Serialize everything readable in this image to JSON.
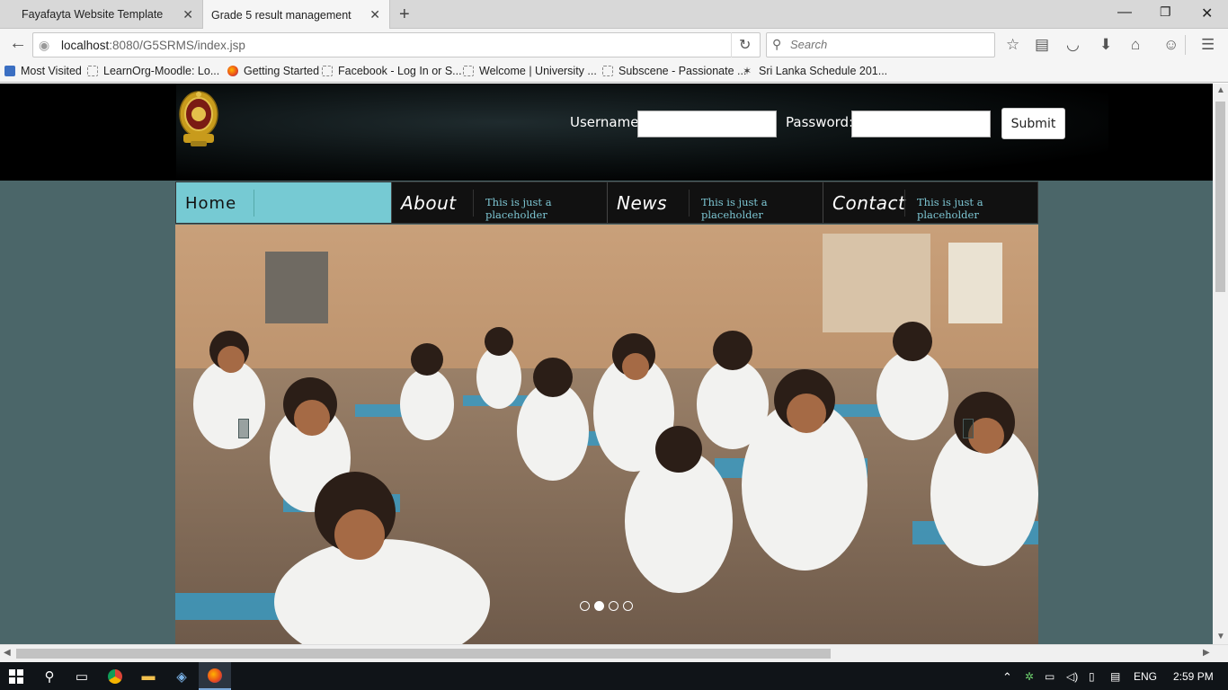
{
  "browser": {
    "tabs": [
      {
        "title": "Fayafayta Website Template",
        "active": false
      },
      {
        "title": "Grade 5 result management",
        "active": true
      }
    ],
    "url_host": "localhost",
    "url_rest": ":8080/G5SRMS/index.jsp",
    "search_placeholder": "Search",
    "bookmarks": [
      {
        "label": "Most Visited",
        "icon": "most-visited-icon"
      },
      {
        "label": "LearnOrg-Moodle: Lo...",
        "icon": "page-icon"
      },
      {
        "label": "Getting Started",
        "icon": "firefox-icon"
      },
      {
        "label": "Facebook - Log In or S...",
        "icon": "page-icon"
      },
      {
        "label": "Welcome | University ...",
        "icon": "page-icon"
      },
      {
        "label": "Subscene - Passionate ...",
        "icon": "page-icon"
      },
      {
        "label": "Sri Lanka Schedule 201...",
        "icon": "star-icon"
      }
    ]
  },
  "site": {
    "login": {
      "username_label": "Username:",
      "password_label": "Password:",
      "submit_label": "Submit"
    },
    "menu": [
      {
        "name": "Home",
        "desc": ""
      },
      {
        "name": "About",
        "desc": "This is just a placeholder"
      },
      {
        "name": "News",
        "desc": "This is just a placeholder"
      },
      {
        "name": "Contact",
        "desc": "This is just a placeholder"
      }
    ],
    "slider": {
      "slide_count": 4,
      "active_slide": 2
    },
    "colors": {
      "page_bg": "#4b6669",
      "menu_active": "#76cad3",
      "menu_desc": "#7dc6d3",
      "header_bg": "#000000"
    }
  },
  "taskbar": {
    "language": "ENG",
    "time": "2:59 PM"
  }
}
